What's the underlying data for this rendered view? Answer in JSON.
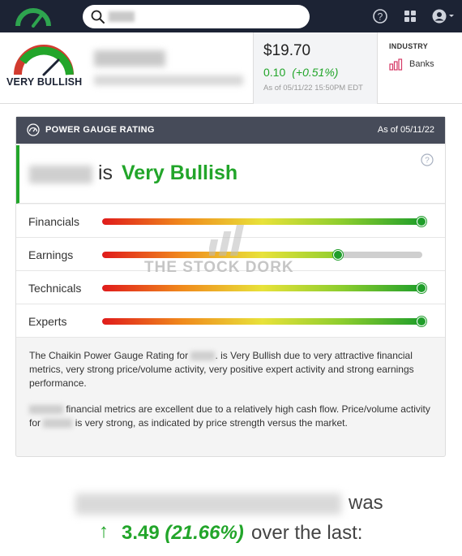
{
  "nav": {
    "search_placeholder": "",
    "icons": [
      "chaikin-logo-icon",
      "search-icon",
      "help-icon",
      "apps-grid-icon",
      "account-icon"
    ]
  },
  "stock": {
    "verdict_label": "VERY BULLISH",
    "price": "$19.70",
    "change": "0.10",
    "change_pct": "(+0.51%)",
    "as_of": "As of 05/11/22 15:50PM EDT",
    "industry_label": "INDUSTRY",
    "industry_value": "Banks"
  },
  "card": {
    "title": "POWER GAUGE RATING",
    "date": "As of 05/11/22",
    "is_word": "is",
    "rating": "Very Bullish",
    "metrics": [
      {
        "label": "Financials",
        "level": 1.0
      },
      {
        "label": "Earnings",
        "level": 0.74
      },
      {
        "label": "Technicals",
        "level": 1.0
      },
      {
        "label": "Experts",
        "level": 1.0
      }
    ],
    "watermark": "THE STOCK DORK",
    "desc1_a": "The Chaikin Power Gauge Rating for",
    "desc1_b": ". is Very Bullish due to very attractive financial metrics, very strong price/volume activity, very positive expert activity and strong earnings performance.",
    "desc2_a": "financial metrics are excellent due to a relatively high cash flow. Price/volume activity for",
    "desc2_b": "is very strong, as indicated by price strength versus the market."
  },
  "bottom": {
    "was": "was",
    "arrow": "↑",
    "gain": "3.49",
    "gain_pct": "(21.66%)",
    "over": "over the last:"
  },
  "colors": {
    "nav_bg": "#1c2334",
    "accent_green": "#22a52a",
    "card_header": "#464b59"
  }
}
